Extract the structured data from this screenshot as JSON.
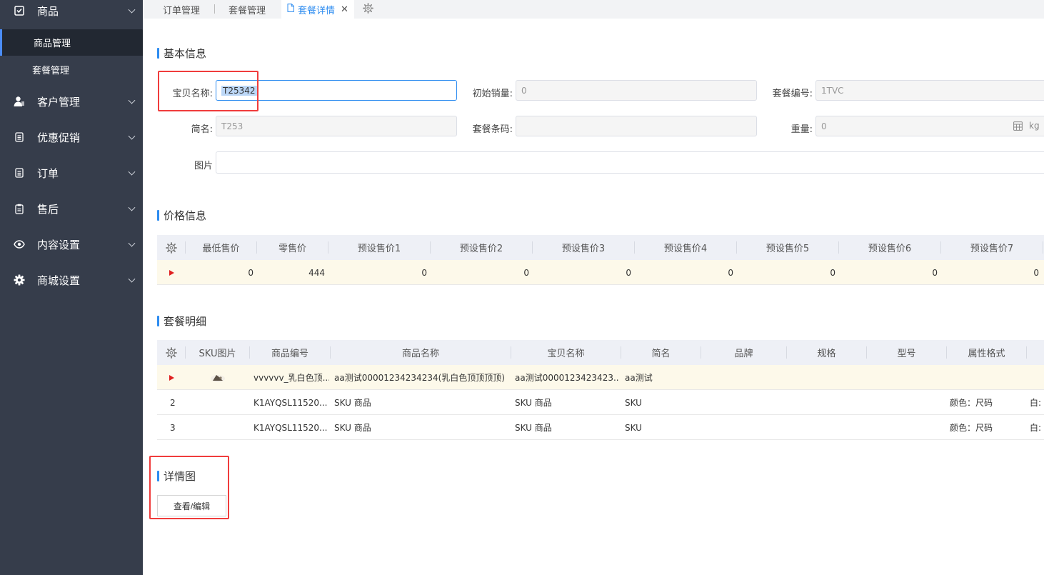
{
  "sidebar": {
    "top_item": {
      "label": "商品",
      "icon": "box-check-icon"
    },
    "sub_items": [
      "商品管理",
      "套餐管理"
    ],
    "items": [
      {
        "label": "客户管理",
        "icon": "user-icon"
      },
      {
        "label": "优惠促销",
        "icon": "list-icon"
      },
      {
        "label": "订单",
        "icon": "list-icon"
      },
      {
        "label": "售后",
        "icon": "clipboard-icon"
      },
      {
        "label": "内容设置",
        "icon": "eye-icon"
      },
      {
        "label": "商城设置",
        "icon": "gear-icon"
      }
    ]
  },
  "tabs": [
    {
      "label": "订单管理",
      "active": false
    },
    {
      "label": "套餐管理",
      "active": false
    },
    {
      "label": "套餐详情",
      "active": true
    }
  ],
  "basic": {
    "title": "基本信息",
    "item_name_label": "宝贝名称:",
    "item_name_value": "T25342",
    "init_sales_label": "初始销量:",
    "init_sales_value": "0",
    "package_code_label": "套餐编号:",
    "package_code_value": "1TVC",
    "short_name_label": "简名:",
    "short_name_value": "T253",
    "barcode_label": "套餐条码:",
    "barcode_value": "",
    "weight_label": "重量:",
    "weight_value": "0",
    "weight_unit": "kg",
    "image_label": "图片"
  },
  "price": {
    "title": "价格信息",
    "headers": [
      "最低售价",
      "零售价",
      "预设售价1",
      "预设售价2",
      "预设售价3",
      "预设售价4",
      "预设售价5",
      "预设售价6",
      "预设售价7"
    ],
    "values": [
      "0",
      "444",
      "0",
      "0",
      "0",
      "0",
      "0",
      "0",
      "0"
    ]
  },
  "detail": {
    "title": "套餐明细",
    "headers": [
      "SKU图片",
      "商品编号",
      "商品名称",
      "宝贝名称",
      "简名",
      "品牌",
      "规格",
      "型号",
      "属性格式"
    ],
    "rows": [
      {
        "idx": "",
        "code": "vvvvvv_乳白色顶...",
        "name": "aa测试00001234234234(乳白色顶顶顶顶)",
        "item": "aa测试0000123423423...",
        "short": "aa测试",
        "attr": "",
        "extra": ""
      },
      {
        "idx": "2",
        "code": "K1AYQSL11520...",
        "name": "SKU 商品",
        "item": "SKU 商品",
        "short": "SKU",
        "attr": "颜色：尺码",
        "extra": "白:"
      },
      {
        "idx": "3",
        "code": "K1AYQSL11520...",
        "name": "SKU 商品",
        "item": "SKU 商品",
        "short": "SKU",
        "attr": "颜色：尺码",
        "extra": "白:"
      }
    ]
  },
  "images": {
    "title": "详情图",
    "button": "查看/编辑"
  }
}
